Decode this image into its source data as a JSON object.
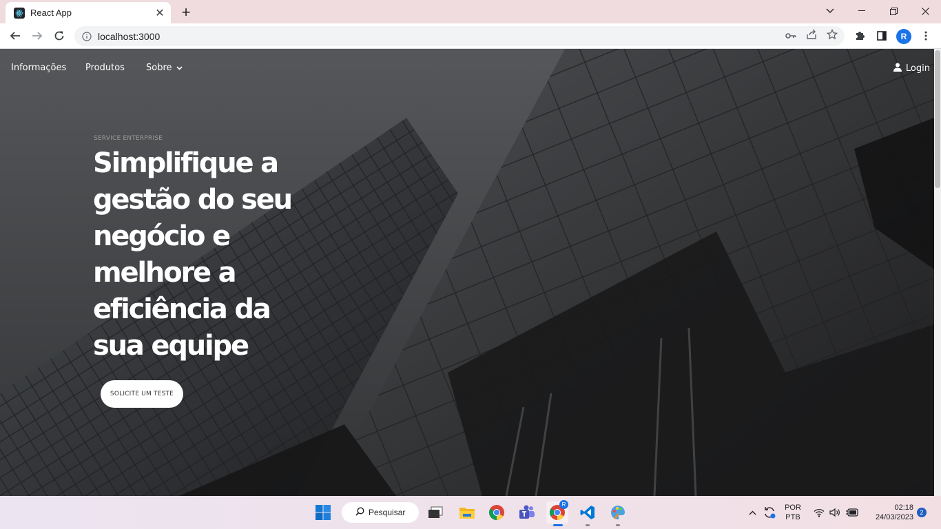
{
  "browser": {
    "tab_title": "React App",
    "url": "localhost:3000",
    "profile_initial": "R"
  },
  "nav": {
    "links": [
      "Informações",
      "Produtos",
      "Sobre"
    ],
    "login": "Login"
  },
  "hero": {
    "eyebrow": "SERVICE ENTERPRISE",
    "title": "Simplifique a gestão do seu negócio e melhore a eficiência da sua equipe",
    "cta": "SOLICITE UM TESTE"
  },
  "taskbar": {
    "search": "Pesquisar",
    "language": "POR",
    "layout": "PTB",
    "time": "02:18",
    "date": "24/03/2023",
    "notifications": "2",
    "chrome_badge": "R"
  },
  "colors": {
    "accent": "#1a73e8",
    "tab_strip": "#f0dcdf"
  }
}
